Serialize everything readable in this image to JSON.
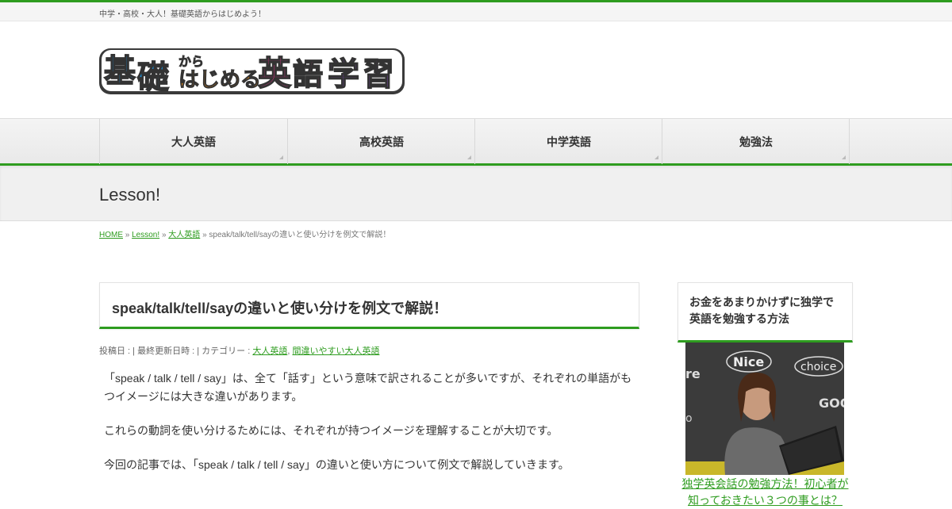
{
  "topbar": {
    "tagline": "中学・高校・大人！基礎英語からはじめよう！"
  },
  "logo": {
    "chars": [
      {
        "t": "基",
        "color": "#1a8fd8"
      },
      {
        "t": "礎",
        "color": "#1a8fd8"
      },
      {
        "t": "から",
        "color": "#e98b16"
      },
      {
        "t": "はじめる",
        "color": "#e98b16"
      },
      {
        "t": "英",
        "color": "#e4338b"
      },
      {
        "t": "語",
        "color": "#e4338b"
      },
      {
        "t": "学",
        "color": "#8a4ac4"
      },
      {
        "t": "習",
        "color": "#8a4ac4"
      }
    ]
  },
  "nav": {
    "items": [
      "大人英語",
      "高校英語",
      "中学英語",
      "勉強法"
    ]
  },
  "category": {
    "title": "Lesson!"
  },
  "breadcrumb": {
    "home": "HOME",
    "lesson": "Lesson!",
    "adult": "大人英語",
    "current": "speak/talk/tell/sayの違いと使い分けを例文で解説！",
    "sep": "»"
  },
  "article": {
    "title": "speak/talk/tell/sayの違いと使い分けを例文で解説！",
    "meta_prefix": "投稿日 : | 最終更新日時 : | カテゴリー : ",
    "cat1": "大人英語",
    "cat_sep": ", ",
    "cat2": "間違いやすい大人英語",
    "p1": "「speak / talk / tell / say」は、全て「話す」という意味で訳されることが多いですが、それぞれの単語がもつイメージには大きな違いがあります。",
    "p2": "これらの動詞を使い分けるためには、それぞれが持つイメージを理解することが大切です。",
    "p3": "今回の記事では、「speak / talk / tell / say」の違いと使い方について例文で解説していきます。"
  },
  "sidebar": {
    "heading": "お金をあまりかけずに独学で英語を勉強する方法",
    "image_words": [
      "Nice",
      "choice",
      "GOO",
      "re",
      "o"
    ],
    "link": "独学英会話の勉強方法！初心者が知っておきたい３つの事とは？"
  },
  "colors": {
    "accent": "#2e9c1f"
  }
}
